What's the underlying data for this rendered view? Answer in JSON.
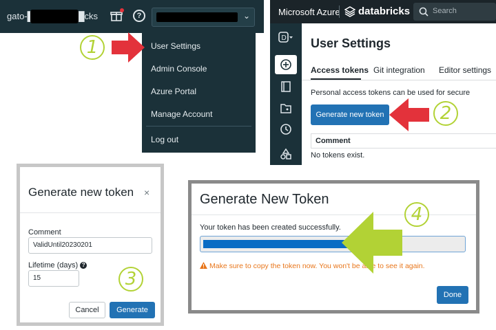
{
  "panel1": {
    "workspace_label": "gato-█████████cks",
    "menu": {
      "items": [
        "User Settings",
        "Admin Console",
        "Azure Portal",
        "Manage Account"
      ],
      "logout": "Log out"
    }
  },
  "panel2": {
    "brand": "Microsoft Azure",
    "product": "databricks",
    "search_placeholder": "Search",
    "title": "User Settings",
    "tabs": [
      "Access tokens",
      "Git integration",
      "Editor settings"
    ],
    "description": "Personal access tokens can be used for secure",
    "generate_button": "Generate new token",
    "table_header": "Comment",
    "empty_text": "No tokens exist."
  },
  "panel3": {
    "title": "Generate new token",
    "close": "×",
    "comment_label": "Comment",
    "comment_value": "ValidUntil20230201",
    "lifetime_label": "Lifetime (days)",
    "lifetime_value": "15",
    "cancel": "Cancel",
    "generate": "Generate"
  },
  "panel4": {
    "title": "Generate New Token",
    "success_text": "Your token has been created successfully.",
    "token_visible_fraction": 0.57,
    "warning_text": "Make sure to copy the token now. You won't be able to see it again.",
    "done": "Done"
  },
  "steps": [
    "1",
    "2",
    "3",
    "4"
  ],
  "colors": {
    "topbar": "#1b3139",
    "primary": "#2272b4",
    "annotation_green": "#b2d235",
    "annotation_red": "#e3323b",
    "warning": "#e8761b"
  }
}
